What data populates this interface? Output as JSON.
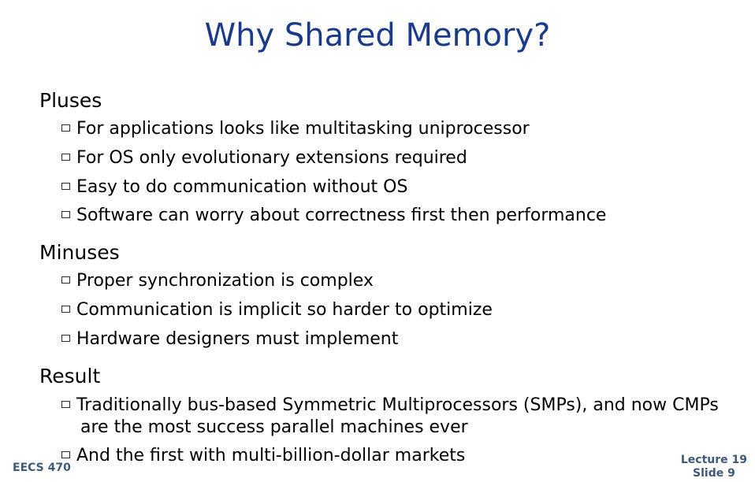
{
  "slide": {
    "title": "Why Shared Memory?",
    "sections": [
      {
        "heading": "Pluses",
        "items": [
          "For applications looks like multitasking uniprocessor",
          "For OS only evolutionary extensions required",
          "Easy to do communication without OS",
          "Software can worry about correctness first then performance"
        ]
      },
      {
        "heading": "Minuses",
        "items": [
          "Proper synchronization is complex",
          "Communication is implicit so harder to optimize",
          "Hardware designers must implement"
        ]
      },
      {
        "heading": "Result",
        "items": [
          "Traditionally bus-based Symmetric Multiprocessors (SMPs), and now CMPs",
          "And the first with multi-billion-dollar markets"
        ],
        "continuation": "are the most success parallel machines ever"
      }
    ],
    "footer": {
      "course": "EECS 470",
      "lecture": "Lecture 19",
      "slide": "Slide 9"
    },
    "colors": {
      "title": "#1a3a8c",
      "footer": "#3d5a7a"
    }
  }
}
